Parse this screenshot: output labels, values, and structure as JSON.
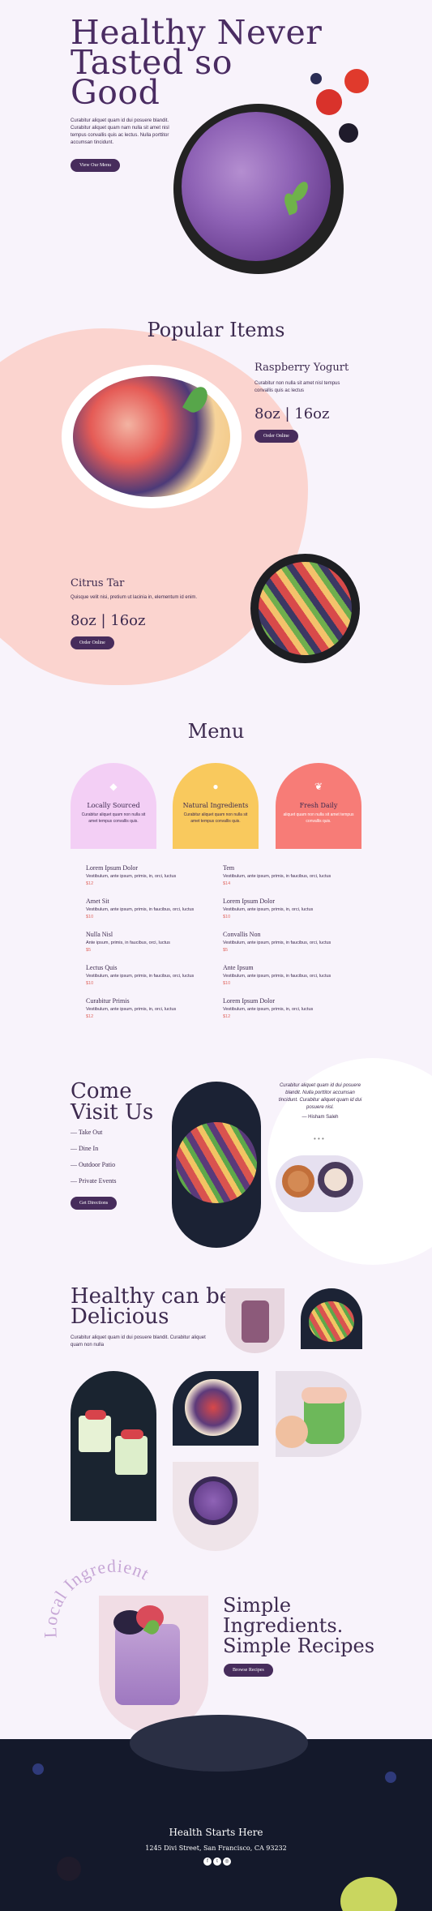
{
  "hero": {
    "title_line1": "Healthy Never",
    "title_line2": "Tasted so",
    "title_line3": "Good",
    "text": "Curabitur aliquet quam id dui posuere blandit. Curabitur aliquet quam nam nulla sit amet nisl tempus convallis quis ac lectus. Nulla porttitor accumsan tincidunt.",
    "button": "View Our Menu"
  },
  "popular": {
    "title": "Popular Items",
    "items": [
      {
        "name": "Raspberry Yogurt",
        "desc": "Curabitur non nulla sit amet nisl tempus convallis quis ac lectus",
        "price": "8oz | 16oz",
        "button": "Order Online"
      },
      {
        "name": "Citrus Tar",
        "desc": "Quisque velit nisi, pretium ut lacinia in, elementum id enim.",
        "price": "8oz | 16oz",
        "button": "Order Online"
      }
    ]
  },
  "menu": {
    "title": "Menu",
    "cards": [
      {
        "title": "Locally Sourced",
        "desc": "Curabitur aliquet quam non nulla sit amet tempus convallis quis.",
        "icon": "◆"
      },
      {
        "title": "Natural Ingredients",
        "desc": "Curabitur aliquet quam non nulla sit amet tempus convallis quis.",
        "icon": "●"
      },
      {
        "title": "Fresh Daily",
        "desc": "aliquet quam non nulla sit amet tempus convallis quis.",
        "icon": "❦"
      }
    ],
    "left": [
      {
        "name": "Lorem Ipsum Dolor",
        "desc": "Vestibulum, ante ipsum, primis, in, orci, luctus",
        "price": "$12"
      },
      {
        "name": "Amet Sit",
        "desc": "Vestibulum, ante ipsum, primis, in faucibus, orci, luctus",
        "price": "$10"
      },
      {
        "name": "Nulla Nisl",
        "desc": "Ante ipsum, primis, in faucibus, orci, luctus",
        "price": "$5"
      },
      {
        "name": "Lectus Quis",
        "desc": "Vestibulum, ante ipsum, primis, in faucibus, orci, luctus",
        "price": "$10"
      },
      {
        "name": "Curabitur Primis",
        "desc": "Vestibulum, ante ipsum, primis, in, orci, luctus",
        "price": "$12"
      }
    ],
    "right": [
      {
        "name": "Tem",
        "desc": "Vestibulum, ante ipsum, primis, in faucibus, orci, luctus",
        "price": "$14"
      },
      {
        "name": "Lorem Ipsum Dolor",
        "desc": "Vestibulum, ante ipsum, primis, in, orci, luctus",
        "price": "$10"
      },
      {
        "name": "Convallis Non",
        "desc": "Vestibulum, ante ipsum, primis, in faucibus, orci, luctus",
        "price": "$5"
      },
      {
        "name": "Ante Ipsum",
        "desc": "Vestibulum, ante ipsum, primis, in faucibus, orci, luctus",
        "price": "$10"
      },
      {
        "name": "Lorem Ipsum Dolor",
        "desc": "Vestibulum, ante ipsum, primis, in, orci, luctus",
        "price": "$12"
      }
    ]
  },
  "visit": {
    "title_line1": "Come",
    "title_line2": "Visit Us",
    "options": [
      "— Take Out",
      "— Dine In",
      "— Outdoor Patio",
      "— Private Events"
    ],
    "button": "Get Directions",
    "quote": "Curabitur aliquet quam id dui posuere blandit. Nulla porttitor accumsan tincidunt. Curabitur aliquet quam id dui posuere nisl.",
    "author": "— Hisham Saleh"
  },
  "healthy": {
    "title_line1": "Healthy can be",
    "title_line2": "Delicious",
    "text": "Curabitur aliquet quam id dui posuere blandit. Curabitur aliquet quam non nulla"
  },
  "ingredients": {
    "arc_text": "Local Ingredients",
    "title_line1": "Simple",
    "title_line2": "Ingredients.",
    "title_line3": "Simple Recipes",
    "button": "Browse Recipes"
  },
  "footer": {
    "cta": "Health Starts Here",
    "address": "1245 Divi Street, San Francisco, CA 93232",
    "social": [
      "f",
      "t",
      "◎"
    ]
  },
  "colors": {
    "purple": "#472c5c",
    "pink": "#fbd4cf",
    "lilac": "#f3cff5",
    "yellow": "#f9c95d",
    "coral": "#f77c77"
  }
}
